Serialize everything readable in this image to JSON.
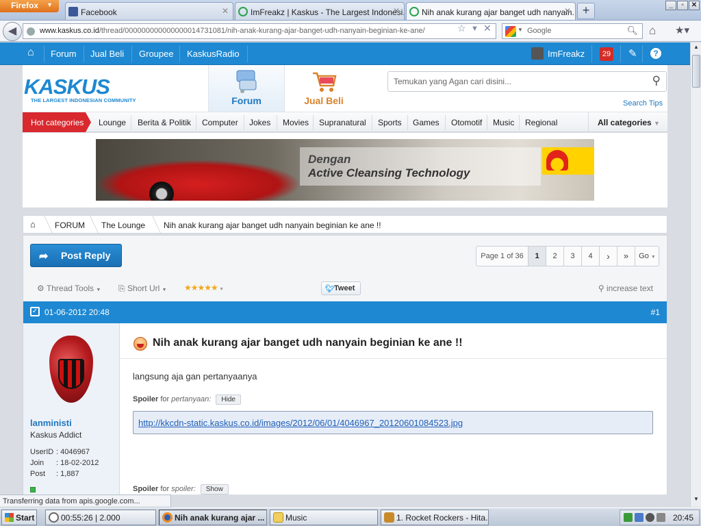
{
  "browser": {
    "menu_button": "Firefox",
    "tabs": [
      {
        "title": "Facebook",
        "color": "#3b5998"
      },
      {
        "title": "ImFreakz | Kaskus - The Largest Indonesi...",
        "color": "#2aa34a"
      },
      {
        "title": "Nih anak kurang ajar banget udh nanyain...",
        "color": "#2aa34a"
      }
    ],
    "new_tab": "+",
    "url_host": "www.kaskus.co.id",
    "url_path": "/thread/000000000000000014731081/nih-anak-kurang-ajar-banget-udh-nanyain-beginian-ke-ane/",
    "search_placeholder": "Google"
  },
  "kaskus_nav": {
    "items": [
      "Forum",
      "Jual Beli",
      "Groupee",
      "KaskusRadio"
    ],
    "username": "ImFreakz",
    "notifications": "29"
  },
  "header": {
    "logo": "KASKUS",
    "logo_tagline": "THE LARGEST INDONESIAN COMMUNITY",
    "tab_forum": "Forum",
    "tab_jual_beli": "Jual Beli",
    "search_placeholder": "Temukan yang Agan cari disini...",
    "search_tips": "Search Tips"
  },
  "categories": {
    "hot": "Hot categories",
    "items": [
      "Lounge",
      "Berita & Politik",
      "Computer",
      "Jokes",
      "Movies",
      "Supranatural",
      "Sports",
      "Games",
      "Otomotif",
      "Music",
      "Regional"
    ],
    "all": "All categories"
  },
  "banner": {
    "line1": "Dengan",
    "line2": "Active Cleansing Technology"
  },
  "breadcrumb": [
    "FORUM",
    "The Lounge",
    "Nih anak kurang ajar banget udh nanyain beginian ke ane !!"
  ],
  "thread": {
    "post_reply": "Post Reply",
    "page_label": "Page 1 of 36",
    "pages": [
      "1",
      "2",
      "3",
      "4"
    ],
    "next": "›",
    "last": "»",
    "go": "Go",
    "thread_tools": "Thread Tools",
    "short_url": "Short Url",
    "rating_stars": 5,
    "tweet": "Tweet",
    "increase_text": "increase text"
  },
  "post": {
    "date": "01-06-2012 20:48",
    "number": "#1",
    "author_name": "lanministi",
    "author_rank": "Kaskus Addict",
    "user_id_label": "UserID",
    "user_id": ": 4046967",
    "join_label": "Join",
    "join": ": 18-02-2012",
    "post_label": "Post",
    "post_count": ": 1,887",
    "title": "Nih anak kurang ajar banget udh nanyain beginian ke ane !!",
    "text": "langsung aja gan pertanyaanya",
    "spoiler1_label": "Spoiler",
    "spoiler1_for": " for ",
    "spoiler1_name": "pertanyaan:",
    "spoiler1_btn": "Hide",
    "spoiler1_link": "http://kkcdn-static.kaskus.co.id/images/2012/06/01/4046967_20120601084523.jpg",
    "spoiler2_label": "Spoiler",
    "spoiler2_for": " for ",
    "spoiler2_name": "spoiler:",
    "spoiler2_btn": "Show"
  },
  "status_text": "Transferring data from apis.google.com...",
  "taskbar": {
    "start": "Start",
    "tasks": [
      "00:55:26 | 2.000",
      "Nih anak kurang ajar ...",
      "Music",
      "1. Rocket Rockers - Hita..."
    ],
    "clock": "20:45"
  }
}
